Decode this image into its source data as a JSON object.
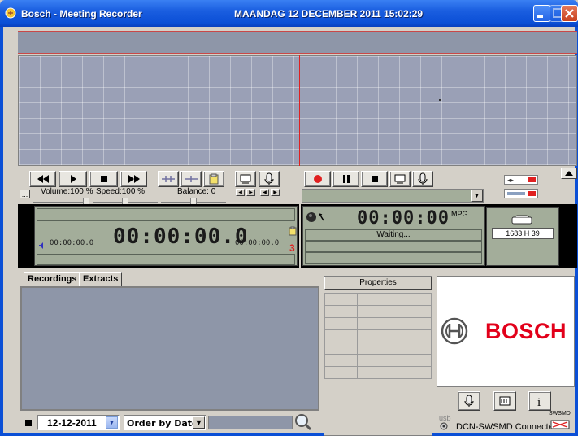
{
  "window": {
    "title": "Bosch - Meeting Recorder",
    "datetime": "MAANDAG 12 DECEMBER 2011 15:02:29"
  },
  "player": {
    "volume_label": "Volume:100 %",
    "speed_label": "Speed:100 %",
    "balance_label": "Balance: 0",
    "more_label": "...",
    "position_start": "00:00:00.0",
    "position_time": "00:00:00.0",
    "position_end": "00:00:00.0"
  },
  "recorder": {
    "time": "00:00:00",
    "format": "MPG",
    "status": "Waiting...",
    "disk_space": "1683 H 39"
  },
  "tabs": [
    "Recordings",
    "Extracts"
  ],
  "properties": {
    "header": "Properties",
    "rows": 7
  },
  "filter": {
    "date": "12-12-2011",
    "sort": "Order by Date"
  },
  "brand": {
    "name": "BOSCH"
  },
  "status": {
    "usb_label": "usb",
    "connection": "DCN-SWSMD Connected",
    "device_label": "SWSMD"
  },
  "colors": {
    "title_bar": "#0b4fd6",
    "waveform_bg": "#9aa0b6",
    "lcd_bg": "#a3ad9a",
    "brand_red": "#e2001a",
    "record_red": "#e02020"
  }
}
